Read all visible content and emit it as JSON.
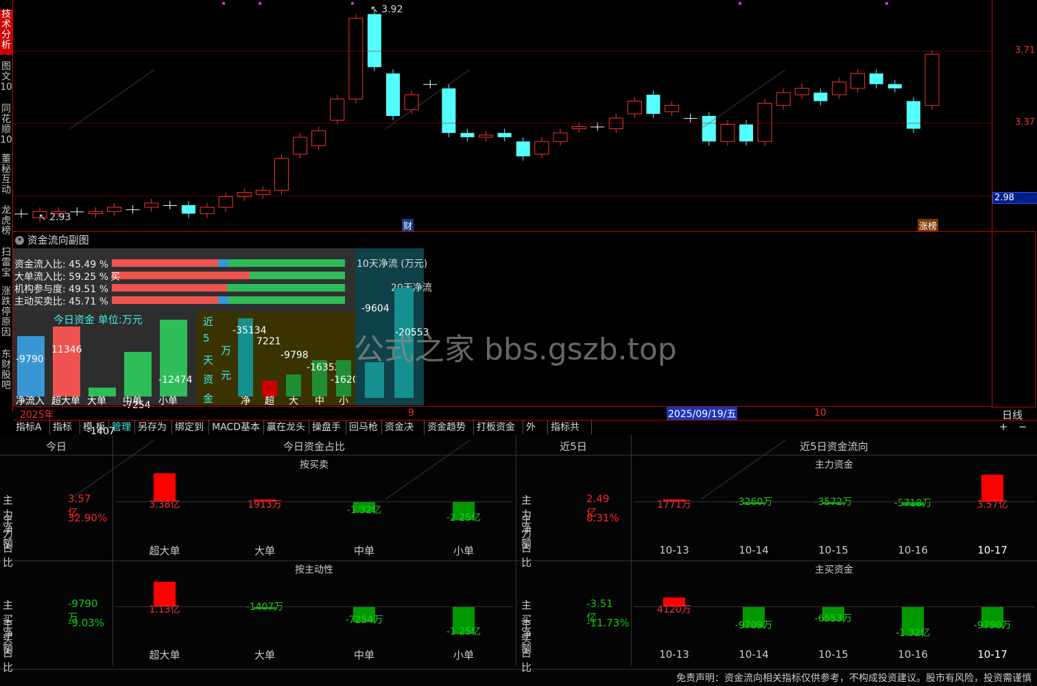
{
  "left_tabs": [
    "技术分析",
    "图文10",
    "同花顺10",
    "董秘互动",
    "龙虎榜",
    "扫雷宝",
    "涨跌停原因",
    "东财股吧"
  ],
  "price_axis": {
    "labels": [
      "3.71",
      "3.37",
      "2.98"
    ]
  },
  "annotations": {
    "high": "3.92",
    "low": "2.93",
    "marker_cai": "财",
    "marker_zhangbang": "涨榜"
  },
  "chart_data": [
    {
      "type": "candlestick",
      "title": "",
      "candles": [
        {
          "o": 2.96,
          "c": 2.96
        },
        {
          "o": 2.94,
          "c": 2.97
        },
        {
          "o": 2.96,
          "c": 2.97
        },
        {
          "o": 2.97,
          "c": 2.97
        },
        {
          "o": 2.96,
          "c": 2.97
        },
        {
          "o": 2.97,
          "c": 2.99
        },
        {
          "o": 2.98,
          "c": 2.98
        },
        {
          "o": 2.99,
          "c": 3.01
        },
        {
          "o": 3.0,
          "c": 3.0
        },
        {
          "o": 3.0,
          "c": 2.96
        },
        {
          "o": 2.96,
          "c": 2.99
        },
        {
          "o": 2.99,
          "c": 3.04
        },
        {
          "o": 3.04,
          "c": 3.06
        },
        {
          "o": 3.05,
          "c": 3.07
        },
        {
          "o": 3.07,
          "c": 3.22
        },
        {
          "o": 3.24,
          "c": 3.32
        },
        {
          "o": 3.28,
          "c": 3.35
        },
        {
          "o": 3.4,
          "c": 3.5
        },
        {
          "o": 3.5,
          "c": 3.88
        },
        {
          "o": 3.9,
          "c": 3.65
        },
        {
          "o": 3.62,
          "c": 3.42
        },
        {
          "o": 3.45,
          "c": 3.52
        },
        {
          "o": 3.57,
          "c": 3.57
        },
        {
          "o": 3.55,
          "c": 3.34
        },
        {
          "o": 3.34,
          "c": 3.32
        },
        {
          "o": 3.32,
          "c": 3.33
        },
        {
          "o": 3.34,
          "c": 3.32
        },
        {
          "o": 3.3,
          "c": 3.23
        },
        {
          "o": 3.24,
          "c": 3.3
        },
        {
          "o": 3.3,
          "c": 3.34
        },
        {
          "o": 3.36,
          "c": 3.37
        },
        {
          "o": 3.37,
          "c": 3.37
        },
        {
          "o": 3.36,
          "c": 3.41
        },
        {
          "o": 3.43,
          "c": 3.49
        },
        {
          "o": 3.52,
          "c": 3.43
        },
        {
          "o": 3.44,
          "c": 3.47
        },
        {
          "o": 3.41,
          "c": 3.41
        },
        {
          "o": 3.42,
          "c": 3.3
        },
        {
          "o": 3.3,
          "c": 3.38
        },
        {
          "o": 3.38,
          "c": 3.3
        },
        {
          "o": 3.3,
          "c": 3.48
        },
        {
          "o": 3.47,
          "c": 3.53
        },
        {
          "o": 3.52,
          "c": 3.55
        },
        {
          "o": 3.53,
          "c": 3.49
        },
        {
          "o": 3.52,
          "c": 3.58
        },
        {
          "o": 3.55,
          "c": 3.62
        },
        {
          "o": 3.62,
          "c": 3.57
        },
        {
          "o": 3.57,
          "c": 3.55
        },
        {
          "o": 3.49,
          "c": 3.36
        },
        {
          "o": 3.47,
          "c": 3.71
        }
      ],
      "ylim": [
        2.9,
        3.95
      ]
    }
  ],
  "sub_chart": {
    "title": "资金流向副图",
    "ratios": [
      {
        "label": "资金流入比: 45.49 %",
        "red": 45.49
      },
      {
        "label": "大单流入比: 59.25 %",
        "red": 59.25
      },
      {
        "label": "机构参与度: 49.51 %",
        "red": 49.51
      },
      {
        "label": "主动买卖比: 45.71 %",
        "red": 45.71
      }
    ],
    "buy_mark": "买",
    "today_title": "今日资金 单位:万元",
    "today_bars": [
      {
        "label": "净流入",
        "value": "-9790",
        "color": "#3a95d4",
        "v": 9790
      },
      {
        "label": "超大单",
        "value": "11346",
        "color": "#ef5350",
        "v": 11346
      },
      {
        "label": "大单",
        "value": "-1407",
        "color": "#2ebd59",
        "v": 1407
      },
      {
        "label": "中单",
        "value": "-7254",
        "color": "#2ebd59",
        "v": 7254
      },
      {
        "label": "小单",
        "value": "-12474",
        "color": "#2ebd59",
        "v": 12474
      }
    ],
    "five_day_title": [
      "近",
      "5",
      "天",
      "资",
      "金",
      "万",
      "元"
    ],
    "five_day_bars": [
      {
        "label": "净",
        "value": "-35134",
        "color": "#168f90",
        "v": 35134
      },
      {
        "label": "超",
        "value": "7221",
        "color": "#c00",
        "v": 7221
      },
      {
        "label": "大",
        "value": "-9798",
        "color": "#1f8f33",
        "v": 9798
      },
      {
        "label": "中",
        "value": "-16352",
        "color": "#1f8f33",
        "v": 16352
      },
      {
        "label": "小",
        "value": "-1620",
        "color": "#1f8f33",
        "v": 16200
      }
    ],
    "ten_day_title": "10天净流 (万元)",
    "ten_day_value": "-9604",
    "twenty_day_title": "20天净流",
    "twenty_day_value": "-20553",
    "watermark_center": "公式之家 bbs.gszb.top"
  },
  "time_axis": {
    "year": "2025年",
    "m9": "9",
    "selected_date": "2025/09/19/五",
    "m10": "10",
    "period": "日线"
  },
  "toolbar": [
    "指标A",
    "指标B",
    "模 板",
    "管理",
    "另存为",
    "绑定到",
    "MACD基本",
    "赢在龙头",
    "操盘手",
    "回马枪",
    "资金决策",
    "资金趋势",
    "打板资金",
    "外资",
    "指标共振"
  ],
  "toolbar_plus": "+",
  "toolbar_minus": "−",
  "bottom": {
    "today_header": "今日",
    "today_share_header": "今日资金占比",
    "five_header": "近5日",
    "five_flow_header": "近5日资金流向",
    "by_trade": "按买卖",
    "by_active": "按主动性",
    "main_fund": "主力资金",
    "active_buy_fund": "主买资金",
    "today_main": [
      {
        "label": "主力净额",
        "value": "3.57亿"
      },
      {
        "label": "主力占比",
        "value": "32.90%"
      }
    ],
    "today_active": [
      {
        "label": "主买净额",
        "value": "-9790万"
      },
      {
        "label": "主买占比",
        "value": "-9.03%"
      }
    ],
    "five_main": [
      {
        "label": "主力净额",
        "value": "2.49亿"
      },
      {
        "label": "主力占比",
        "value": "8.31%"
      }
    ],
    "five_active": [
      {
        "label": "主买净额",
        "value": "-3.51亿"
      },
      {
        "label": "主买占比",
        "value": "-11.73%"
      }
    ],
    "categories": [
      "超大单",
      "大单",
      "中单",
      "小单"
    ],
    "dates": [
      "10-13",
      "10-14",
      "10-15",
      "10-16",
      "10-17"
    ],
    "trade_bars": [
      {
        "value": "3.38亿",
        "v": 3.38
      },
      {
        "value": "1913万",
        "v": 0.19
      },
      {
        "value": "-1.32亿",
        "v": -1.32
      },
      {
        "value": "-2.25亿",
        "v": -2.25
      }
    ],
    "active_bars": [
      {
        "value": "1.13亿",
        "v": 1.13
      },
      {
        "value": "-1407万",
        "v": -0.14
      },
      {
        "value": "-7254万",
        "v": -0.73
      },
      {
        "value": "-1.25亿",
        "v": -1.25
      }
    ],
    "main_flow_bars": [
      {
        "value": "1771万",
        "v": 0.18
      },
      {
        "value": "-3260万",
        "v": -0.33
      },
      {
        "value": "-3572万",
        "v": -0.36
      },
      {
        "value": "-5718万",
        "v": -0.57
      },
      {
        "value": "3.57亿",
        "v": 3.57
      }
    ],
    "active_flow_bars": [
      {
        "value": "4120万",
        "v": 0.41
      },
      {
        "value": "-9709万",
        "v": -0.97
      },
      {
        "value": "-6553万",
        "v": -0.66
      },
      {
        "value": "-1.32亿",
        "v": -1.32
      },
      {
        "value": "-9790万",
        "v": -0.98
      }
    ],
    "disclaimer": "免责声明：资金流向相关指标仅供参考，不构成投资建议。股市有风险，投资需谨慎"
  },
  "colors": {
    "up": "#ff3030",
    "down": "#54ffff",
    "border": "#c00000",
    "bar_up": "#ff0000",
    "bar_down": "#009a00"
  }
}
